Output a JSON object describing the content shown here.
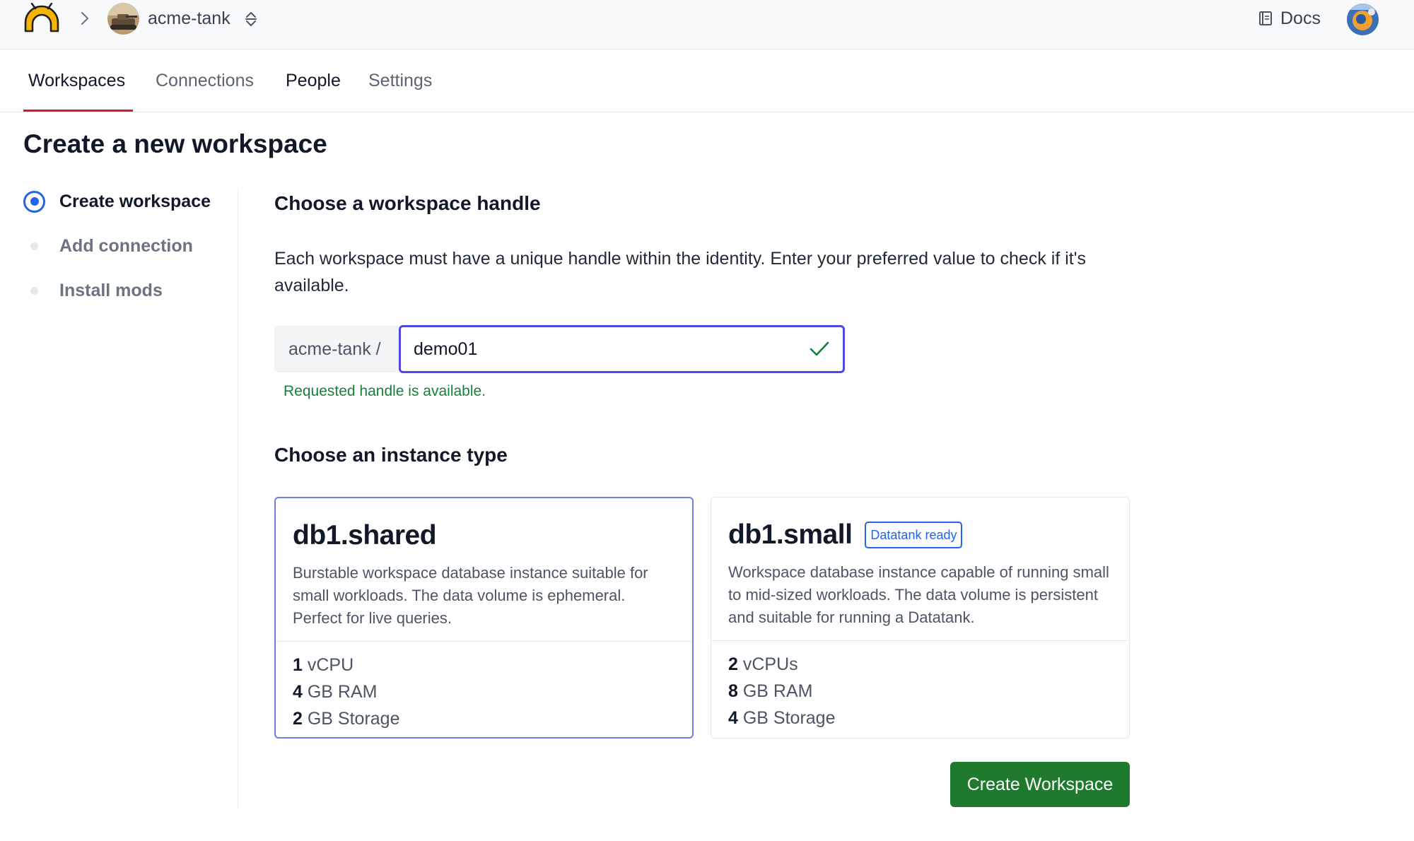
{
  "topbar": {
    "org_name": "acme-tank",
    "docs_label": "Docs",
    "icons": [
      "logo-icon",
      "chevron-right-icon",
      "org-avatar",
      "switch-org-icon",
      "book-icon",
      "user-avatar"
    ]
  },
  "tabs": [
    {
      "label": "Workspaces",
      "active": true
    },
    {
      "label": "Connections",
      "active": false
    },
    {
      "label": "People",
      "active": false
    },
    {
      "label": "Settings",
      "active": false
    }
  ],
  "page": {
    "title": "Create a new workspace"
  },
  "steps": [
    {
      "label": "Create workspace",
      "state": "current"
    },
    {
      "label": "Add connection",
      "state": "pending"
    },
    {
      "label": "Install mods",
      "state": "pending"
    }
  ],
  "handle_section": {
    "heading": "Choose a workspace handle",
    "description": "Each workspace must have a unique handle within the identity. Enter your preferred value to check if it's available.",
    "prefix": "acme-tank /",
    "value": "demo01",
    "status_message": "Requested handle is available."
  },
  "instance_section": {
    "heading": "Choose an instance type",
    "options": [
      {
        "name": "db1.shared",
        "badge": "",
        "selected": true,
        "description": "Burstable workspace database instance suitable for small workloads. The data volume is ephemeral. Perfect for live queries.",
        "specs": [
          {
            "value": "1",
            "unit": "vCPU"
          },
          {
            "value": "4",
            "unit": "GB RAM"
          },
          {
            "value": "2",
            "unit": "GB Storage"
          }
        ]
      },
      {
        "name": "db1.small",
        "badge": "Datatank ready",
        "selected": false,
        "description": "Workspace database instance capable of running small to mid-sized workloads. The data volume is persistent and suitable for running a Datatank.",
        "specs": [
          {
            "value": "2",
            "unit": "vCPUs"
          },
          {
            "value": "8",
            "unit": "GB RAM"
          },
          {
            "value": "4",
            "unit": "GB Storage"
          }
        ]
      }
    ]
  },
  "actions": {
    "create_label": "Create Workspace"
  },
  "colors": {
    "accent_tab": "#c81e2e",
    "input_focus": "#4f46e5",
    "success": "#15803d",
    "primary_button": "#1f7a2e",
    "badge": "#2563eb"
  }
}
